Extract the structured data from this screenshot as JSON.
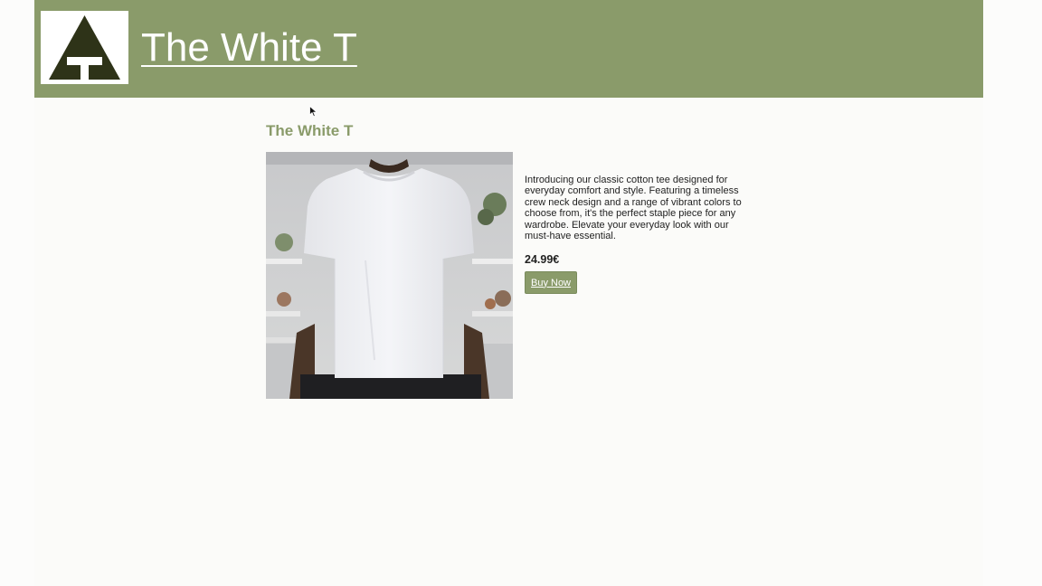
{
  "header": {
    "site_title": "The White T",
    "logo_icon": "tree-t-logo-icon",
    "background_color": "#8a9b6a",
    "logo_color": "#2e3318"
  },
  "product": {
    "title": "The White T",
    "image_icon": "white-tshirt-photo",
    "description": "Introducing our classic cotton tee designed for everyday comfort and style. Featuring a timeless crew neck design and a range of vibrant colors to choose from, it's the perfect staple piece for any wardrobe. Elevate your everyday look with our must-have essential.",
    "price": "24.99€",
    "buy_label": "Buy Now"
  },
  "colors": {
    "accent": "#8a9b6a",
    "page_background": "#fbfbf9"
  }
}
